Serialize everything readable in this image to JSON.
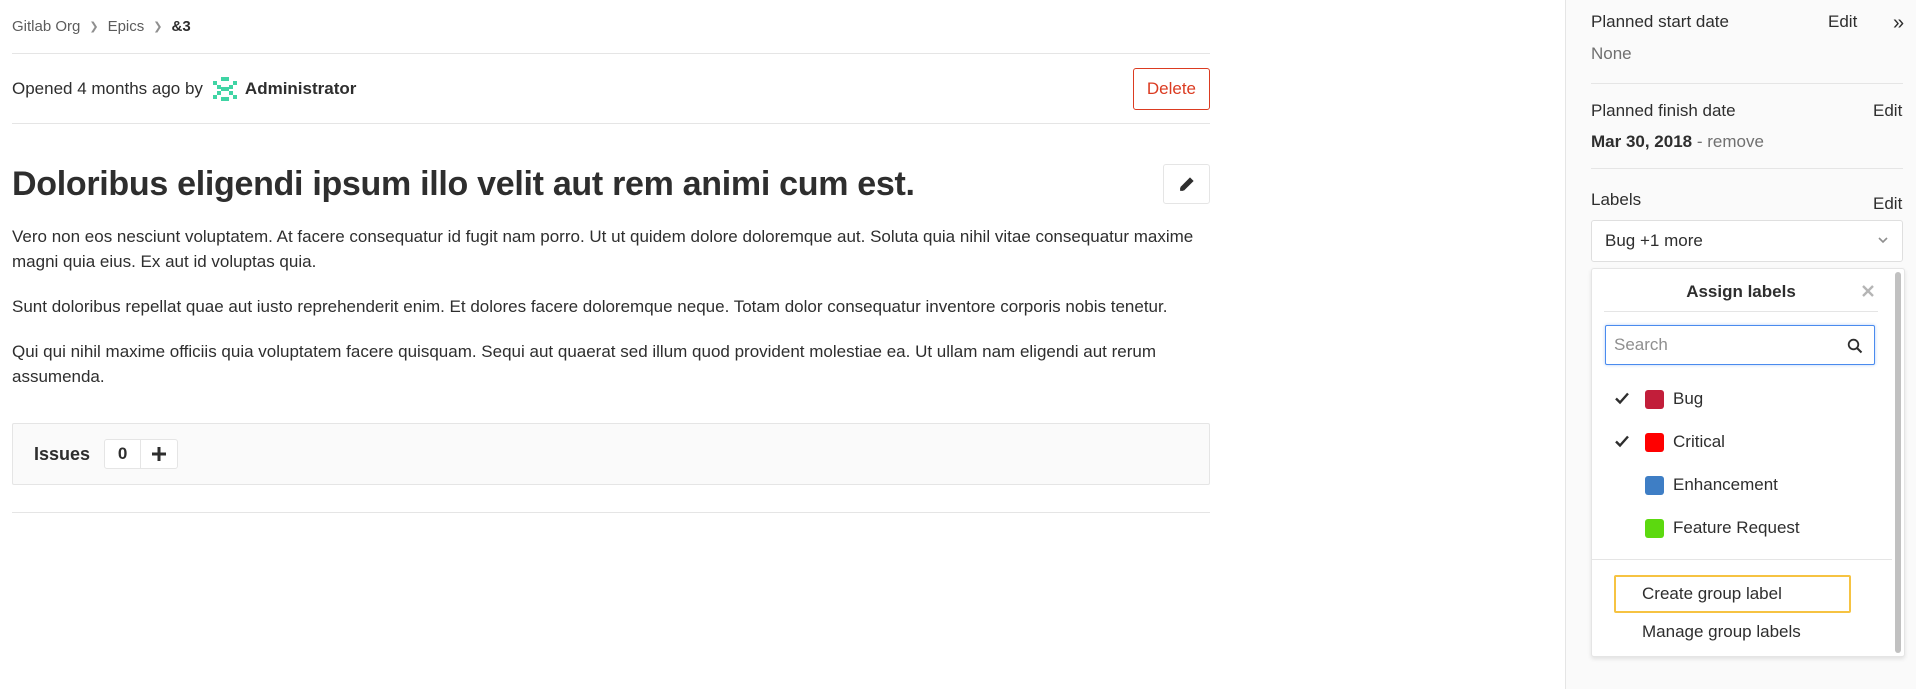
{
  "breadcrumb": {
    "items": [
      "Gitlab Org",
      "Epics"
    ],
    "current": "&3"
  },
  "header": {
    "opened_text": "Opened 4 months ago by",
    "author": "Administrator",
    "delete_label": "Delete"
  },
  "epic": {
    "title": "Doloribus eligendi ipsum illo velit aut rem animi cum est.",
    "description": [
      "Vero non eos nesciunt voluptatem. At facere consequatur id fugit nam porro. Ut ut quidem dolore doloremque aut. Soluta quia nihil vitae consequatur maxime magni quia eius. Ex aut id voluptas quia.",
      "Sunt doloribus repellat quae aut iusto reprehenderit enim. Et dolores facere doloremque neque. Totam dolor consequatur inventore corporis nobis tenetur.",
      "Qui qui nihil maxime officiis quia voluptatem facere quisquam. Sequi aut quaerat sed illum quod provident molestiae ea. Ut ullam nam eligendi aut rerum assumenda."
    ]
  },
  "issues": {
    "title": "Issues",
    "count": "0",
    "add_icon": "plus-icon"
  },
  "sidebar": {
    "start_date": {
      "title": "Planned start date",
      "edit": "Edit",
      "value": "None"
    },
    "finish_date": {
      "title": "Planned finish date",
      "edit": "Edit",
      "value": "Mar 30, 2018",
      "remove": "- remove"
    },
    "labels": {
      "title": "Labels",
      "edit": "Edit",
      "selected": "Bug +1 more"
    },
    "collapse_icon": "double-chevron-right-icon"
  },
  "labels_dropdown": {
    "title": "Assign labels",
    "search_placeholder": "Search",
    "items": [
      {
        "name": "Bug",
        "color": "#c21e3a",
        "checked": true
      },
      {
        "name": "Critical",
        "color": "#ff0000",
        "checked": true
      },
      {
        "name": "Enhancement",
        "color": "#3e7ec5",
        "checked": false
      },
      {
        "name": "Feature Request",
        "color": "#5cd90f",
        "checked": false
      }
    ],
    "create_label": "Create group label",
    "manage_label": "Manage group labels"
  }
}
